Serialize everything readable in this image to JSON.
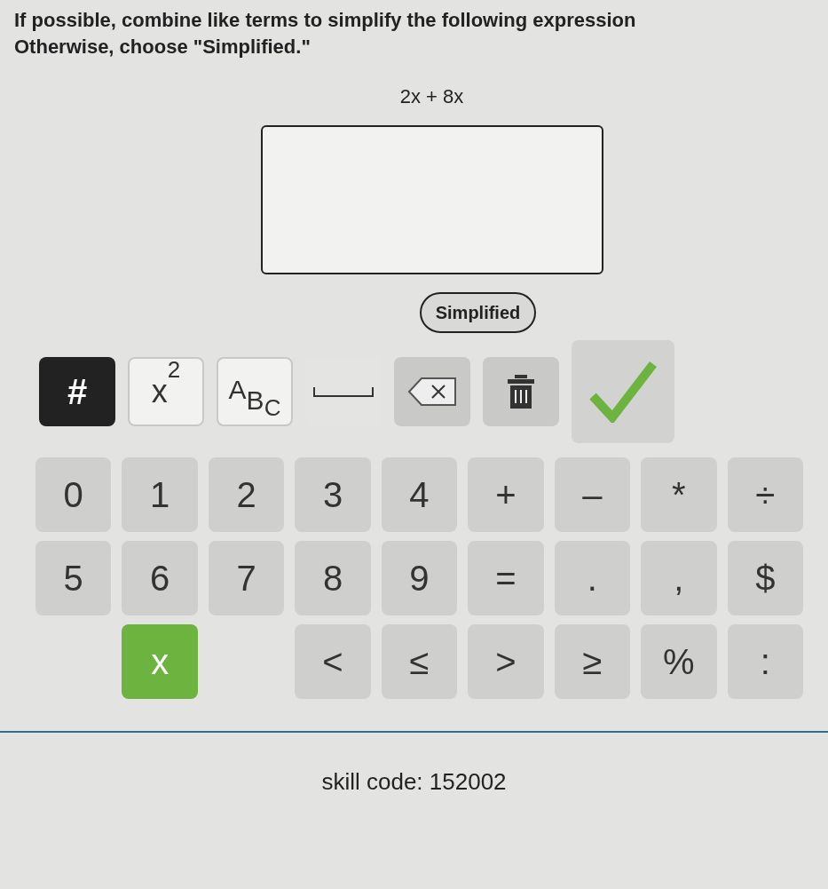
{
  "prompt": {
    "line1": "If possible, combine like terms to simplify the following expression",
    "line2": "Otherwise, choose \"Simplified.\""
  },
  "expression": "2x + 8x",
  "simplified_button": "Simplified",
  "toolbar": [
    {
      "kind": "hash",
      "text": "#"
    },
    {
      "kind": "superscript",
      "base": "x",
      "exp": "2"
    },
    {
      "kind": "subscript",
      "text": "A",
      "sub1": "B",
      "sub2": "C"
    },
    {
      "kind": "space"
    },
    {
      "kind": "backspace"
    },
    {
      "kind": "trash"
    },
    {
      "kind": "check"
    }
  ],
  "keypad": [
    [
      {
        "kind": "key",
        "text": "0"
      },
      {
        "kind": "key",
        "text": "1"
      },
      {
        "kind": "key",
        "text": "2"
      },
      {
        "kind": "key",
        "text": "3"
      },
      {
        "kind": "key",
        "text": "4"
      },
      {
        "kind": "key",
        "text": "+"
      },
      {
        "kind": "key",
        "text": "–"
      },
      {
        "kind": "key",
        "text": "*"
      },
      {
        "kind": "key",
        "text": "÷"
      }
    ],
    [
      {
        "kind": "key",
        "text": "5"
      },
      {
        "kind": "key",
        "text": "6"
      },
      {
        "kind": "key",
        "text": "7"
      },
      {
        "kind": "key",
        "text": "8"
      },
      {
        "kind": "key",
        "text": "9"
      },
      {
        "kind": "key",
        "text": "="
      },
      {
        "kind": "key",
        "text": "."
      },
      {
        "kind": "key",
        "text": ","
      },
      {
        "kind": "key",
        "text": "$"
      }
    ],
    [
      {
        "kind": "gap"
      },
      {
        "kind": "variable",
        "text": "x"
      },
      {
        "kind": "gap"
      },
      {
        "kind": "key",
        "text": "<"
      },
      {
        "kind": "key",
        "text": "≤"
      },
      {
        "kind": "key",
        "text": ">"
      },
      {
        "kind": "key",
        "text": "≥"
      },
      {
        "kind": "key",
        "text": "%"
      },
      {
        "kind": "key",
        "text": ":"
      }
    ]
  ],
  "footer": "skill code: 152002"
}
